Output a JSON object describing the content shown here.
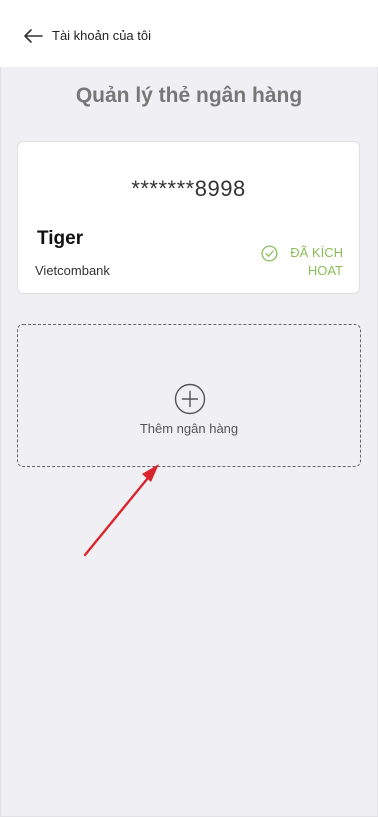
{
  "header": {
    "title": "Tài khoản của tôi"
  },
  "page": {
    "title": "Quản lý thẻ ngân hàng"
  },
  "card": {
    "number": "*******8998",
    "holder": "Tiger",
    "bank": "Vietcombank",
    "status_line1": "ĐÃ KÍCH",
    "status_line2": "HOAT",
    "status_color": "#8bbf5a"
  },
  "add_bank": {
    "label": "Thêm ngân hàng"
  },
  "annotation": {
    "arrow_color": "#d9262e"
  },
  "icons": [
    "back-arrow-icon",
    "check-circle-icon",
    "plus-circle-icon"
  ]
}
